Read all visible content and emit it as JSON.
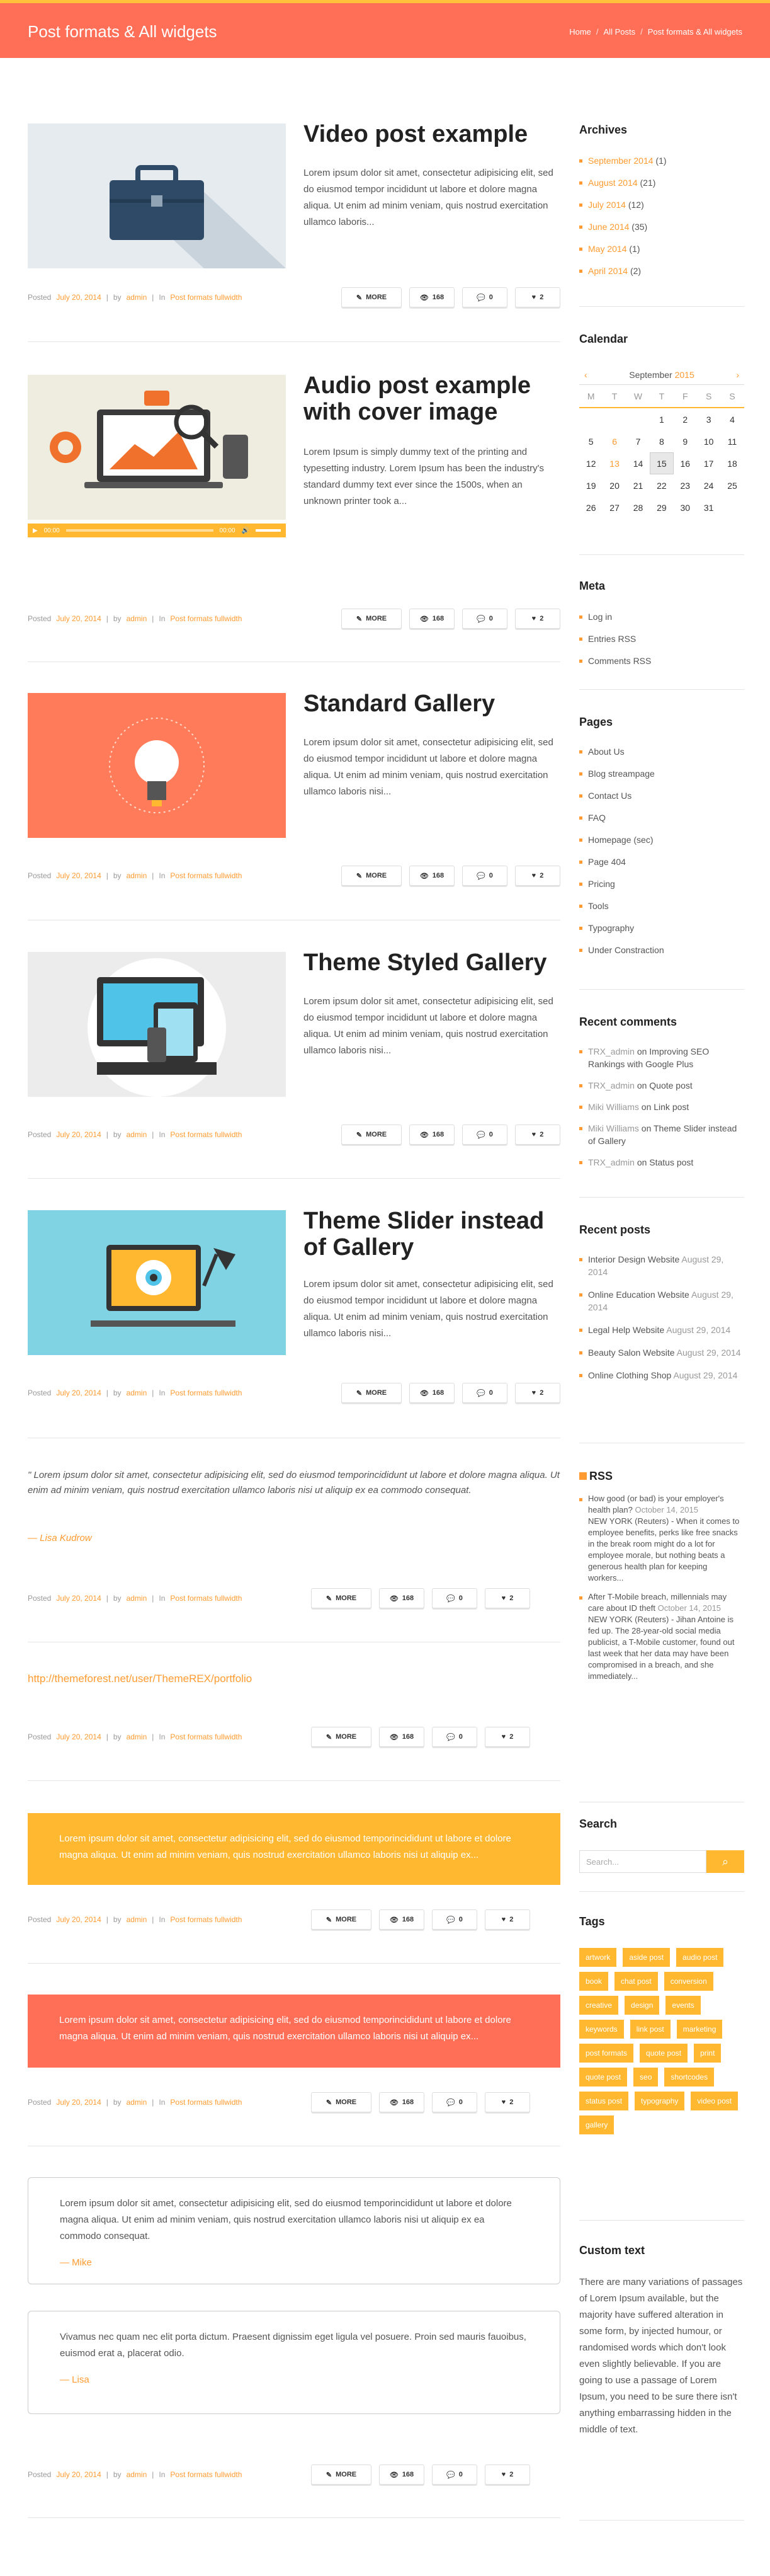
{
  "header": {
    "title": "Post formats & All widgets",
    "breadcrumbs": [
      "Home",
      "All Posts",
      "Post formats & All widgets"
    ]
  },
  "posts": [
    {
      "title": "Video post example",
      "excerpt": "Lorem ipsum dolor sit amet, consectetur adipisicing elit, sed do eiusmod tempor incididunt ut labore et dolore magna aliqua. Ut enim ad minim veniam, quis nostrud exercitation ullamco laboris...",
      "date": "July 20, 2014",
      "author": "admin",
      "category": "Post formats fullwidth",
      "more": "MORE",
      "views": "168",
      "comments": "0",
      "likes": "2"
    },
    {
      "title": "Audio post example with cover image",
      "excerpt": "Lorem Ipsum is simply dummy text of the printing and typesetting industry. Lorem Ipsum has been the industry's standard dummy text ever since the 1500s, when an unknown printer took a...",
      "date": "July 20, 2014",
      "author": "admin",
      "category": "Post formats fullwidth",
      "more": "MORE",
      "views": "168",
      "comments": "0",
      "likes": "2",
      "audio_time": "00:00"
    },
    {
      "title": "Standard Gallery",
      "excerpt": "Lorem ipsum dolor sit amet, consectetur adipisicing elit, sed do eiusmod tempor incididunt ut labore et dolore magna aliqua. Ut enim ad minim veniam, quis nostrud exercitation ullamco laboris nisi...",
      "date": "July 20, 2014",
      "author": "admin",
      "category": "Post formats fullwidth",
      "more": "MORE",
      "views": "168",
      "comments": "0",
      "likes": "2"
    },
    {
      "title": "Theme Styled Gallery",
      "excerpt": "Lorem ipsum dolor sit amet, consectetur adipisicing elit, sed do eiusmod tempor incididunt ut labore et dolore magna aliqua. Ut enim ad minim veniam, quis nostrud exercitation ullamco laboris nisi...",
      "date": "July 20, 2014",
      "author": "admin",
      "category": "Post formats fullwidth",
      "more": "MORE",
      "views": "168",
      "comments": "0",
      "likes": "2"
    },
    {
      "title": "Theme Slider instead of Gallery",
      "excerpt": "Lorem ipsum dolor sit amet, consectetur adipisicing elit, sed do eiusmod tempor incididunt ut labore et dolore magna aliqua. Ut enim ad minim veniam, quis nostrud exercitation ullamco laboris nisi...",
      "date": "July 20, 2014",
      "author": "admin",
      "category": "Post formats fullwidth",
      "more": "MORE",
      "views": "168",
      "comments": "0",
      "likes": "2"
    }
  ],
  "quote_post": {
    "text": "\" Lorem ipsum dolor sit amet, consectetur adipisicing elit, sed do eiusmod temporincididunt ut labore et dolore magna aliqua. Ut enim ad minim veniam, quis nostrud exercitation ullamco laboris nisi ut aliquip ex ea commodo consequat.",
    "author": "— Lisa Kudrow"
  },
  "link_post": {
    "url": "http://themeforest.net/user/ThemeREX/portfolio"
  },
  "status_yellow": "Lorem ipsum dolor sit amet, consectetur adipisicing elit, sed do eiusmod temporincididunt ut labore et dolore magna aliqua. Ut enim ad minim veniam, quis nostrud exercitation ullamco laboris nisi ut aliquip ex...",
  "status_red": "Lorem ipsum dolor sit amet, consectetur adipisicing elit, sed do eiusmod temporincididunt ut labore et dolore magna aliqua. Ut enim ad minim veniam, quis nostrud exercitation ullamco laboris nisi ut aliquip ex...",
  "testimonials": [
    {
      "text": "Lorem ipsum dolor sit amet, consectetur adipisicing elit, sed do eiusmod temporincididunt ut labore et dolore magna aliqua. Ut enim ad minim veniam, quis nostrud exercitation ullamco laboris nisi ut aliquip ex ea commodo consequat.",
      "author": "— Mike"
    },
    {
      "text": "Vivamus nec quam nec elit porta dictum. Praesent dignissim eget ligula vel posuere. Proin sed mauris fauoibus, euismod erat a, placerat odio.",
      "author": "— Lisa"
    }
  ],
  "meta_common": {
    "posted": "Posted",
    "by": "by",
    "in": "In",
    "sep": "|",
    "date": "July 20, 2014",
    "author": "admin",
    "category": "Post formats fullwidth",
    "more": "MORE",
    "views": "168",
    "comments": "0",
    "likes": "2"
  },
  "sidebar": {
    "archives": {
      "title": "Archives",
      "items": [
        [
          "September 2014",
          "(1)"
        ],
        [
          "August 2014",
          "(21)"
        ],
        [
          "July 2014",
          "(12)"
        ],
        [
          "June 2014",
          "(35)"
        ],
        [
          "May 2014",
          "(1)"
        ],
        [
          "April 2014",
          "(2)"
        ]
      ]
    },
    "calendar": {
      "title": "Calendar",
      "month": "September",
      "year": "2015",
      "prev": "‹",
      "next": "›",
      "days": [
        "M",
        "T",
        "W",
        "T",
        "F",
        "S",
        "S"
      ],
      "weeks": [
        [
          "",
          "",
          "",
          "",
          "",
          "",
          ""
        ],
        [
          "",
          "",
          "",
          "1",
          "2",
          "3",
          "4"
        ],
        [
          "5",
          "6",
          "7",
          "8",
          "9",
          "10",
          "11"
        ],
        [
          "12",
          "13",
          "14",
          "15",
          "16",
          "17",
          "18"
        ],
        [
          "19",
          "20",
          "21",
          "22",
          "23",
          "24",
          "25"
        ],
        [
          "26",
          "27",
          "28",
          "29",
          "30",
          "31",
          ""
        ]
      ]
    },
    "meta": {
      "title": "Meta",
      "items": [
        "Log in",
        "Entries RSS",
        "Comments RSS"
      ]
    },
    "pages": {
      "title": "Pages",
      "items": [
        "About Us",
        "Blog streampage",
        "Contact Us",
        "FAQ",
        "Homepage (sec)",
        "Page 404",
        "Pricing",
        "Tools",
        "Typography",
        "Under Constraction"
      ]
    },
    "recent_comments": {
      "title": "Recent comments",
      "on": "on",
      "items": [
        [
          "TRX_admin",
          "Improving SEO Rankings with Google Plus"
        ],
        [
          "TRX_admin",
          "Quote post"
        ],
        [
          "Miki Williams",
          "Link post"
        ],
        [
          "Miki Williams",
          "Theme Slider instead of Gallery"
        ],
        [
          "TRX_admin",
          "Status post"
        ]
      ]
    },
    "recent_posts": {
      "title": "Recent posts",
      "items": [
        [
          "Interior Design Website",
          "August 29, 2014"
        ],
        [
          "Online Education Website",
          "August 29, 2014"
        ],
        [
          "Legal Help Website",
          "August 29, 2014"
        ],
        [
          "Beauty Salon Website",
          "August 29, 2014"
        ],
        [
          "Online Clothing Shop",
          "August 29, 2014"
        ]
      ]
    },
    "rss": {
      "title": "RSS",
      "items": [
        {
          "head": "How good (or bad) is your employer's health plan?",
          "date": "October 14, 2015",
          "body": "NEW YORK (Reuters) - When it comes to employee benefits, perks like free snacks in the break room might do a lot for employee morale, but nothing beats a generous health plan for keeping workers..."
        },
        {
          "head": "After T-Mobile breach, millennials may care about ID theft",
          "date": "October 14, 2015",
          "body": "NEW YORK (Reuters) - Jihan Antoine is fed up. The 28-year-old social media publicist, a T-Mobile customer, found out last week that her data may have been compromised in a breach, and she immediately..."
        }
      ]
    },
    "search": {
      "title": "Search",
      "placeholder": "Search..."
    },
    "tags": {
      "title": "Tags",
      "items": [
        "artwork",
        "aside post",
        "audio post",
        "book",
        "chat post",
        "conversion",
        "creative",
        "design",
        "events",
        "keywords",
        "link post",
        "marketing",
        "post formats",
        "quote post",
        "print",
        "quote post",
        "seo",
        "shortcodes",
        "status post",
        "typography",
        "video post",
        "gallery"
      ]
    },
    "custom_text": {
      "title": "Custom text",
      "text": "There are many variations of passages of Lorem Ipsum available, but the majority have suffered alteration in some form, by injected humour, or randomised words which don't look even slightly believable. If you are going to use a passage of Lorem Ipsum, you need to be sure there isn't anything embarrassing hidden in the middle of text."
    }
  },
  "colors": {
    "header": "#ff6e56",
    "accent": "#ff9b30",
    "yellow": "#ffb830",
    "red": "#ff6e56"
  }
}
